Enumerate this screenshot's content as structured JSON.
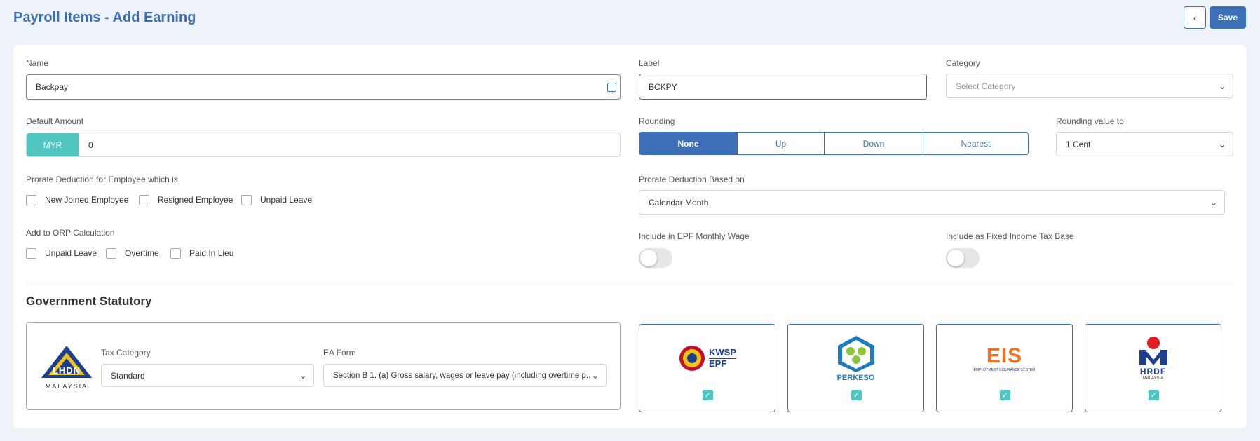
{
  "header": {
    "title": "Payroll Items - Add Earning",
    "back_icon": "‹",
    "save_label": "Save"
  },
  "form": {
    "name": {
      "label": "Name",
      "value": "Backpay"
    },
    "label_field": {
      "label": "Label",
      "value": "BCKPY"
    },
    "category": {
      "label": "Category",
      "placeholder": "Select Category"
    },
    "default_amount": {
      "label": "Default Amount",
      "currency": "MYR",
      "value": "0"
    },
    "rounding": {
      "label": "Rounding",
      "options": [
        "None",
        "Up",
        "Down",
        "Nearest"
      ],
      "selected": "None"
    },
    "rounding_value": {
      "label": "Rounding value to",
      "value": "1 Cent"
    },
    "prorate": {
      "label": "Prorate Deduction for Employee which is",
      "options": [
        "New Joined Employee",
        "Resigned Employee",
        "Unpaid Leave"
      ]
    },
    "prorate_basis": {
      "label": "Prorate Deduction Based on",
      "value": "Calendar Month"
    },
    "orp": {
      "label": "Add to ORP Calculation",
      "options": [
        "Unpaid Leave",
        "Overtime",
        "Paid In Lieu"
      ]
    },
    "epf_wage": {
      "label": "Include in EPF Monthly Wage",
      "on": false
    },
    "fixed_tax": {
      "label": "Include as Fixed Income Tax Base",
      "on": false
    }
  },
  "statutory": {
    "title": "Government Statutory",
    "lhdn": {
      "logo_text": "LHDN",
      "logo_sub": "MALAYSIA"
    },
    "tax_category": {
      "label": "Tax Category",
      "value": "Standard"
    },
    "ea_form": {
      "label": "EA Form",
      "value": "Section B 1. (a) Gross salary, wages or leave pay (including overtime p..."
    },
    "cards": [
      {
        "name": "KWSP EPF",
        "line1": "KWSP",
        "line2": "EPF",
        "checked": true
      },
      {
        "name": "PERKESO",
        "line1": "PERKESO",
        "checked": true
      },
      {
        "name": "EIS",
        "line1": "EIS",
        "line2": "EMPLOYMENT INSURANCE SYSTEM",
        "checked": true
      },
      {
        "name": "HRDF",
        "line1": "HRDF",
        "line2": "MALAYSIA",
        "checked": true
      }
    ]
  },
  "colors": {
    "primary": "#3d6fb6",
    "accent": "#4fc7c0",
    "background": "#eef3f9"
  }
}
